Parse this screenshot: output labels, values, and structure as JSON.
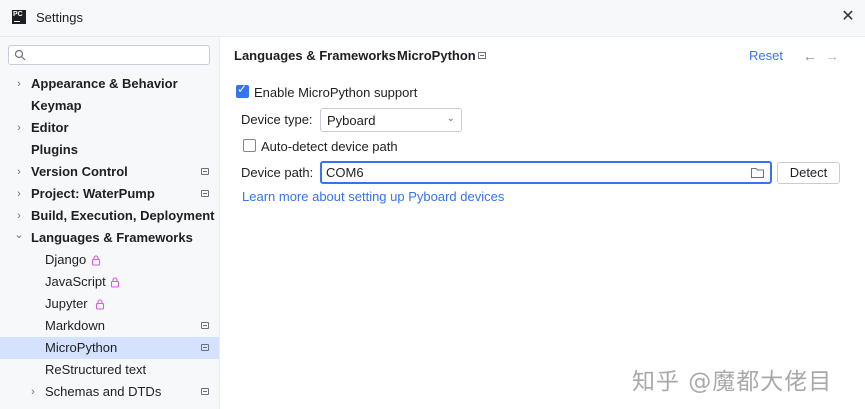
{
  "window": {
    "title": "Settings",
    "app_icon_text": "PC"
  },
  "sidebar": {
    "search_placeholder": "",
    "items": [
      {
        "label": "Appearance & Behavior",
        "arrow": "›"
      },
      {
        "label": "Keymap"
      },
      {
        "label": "Editor",
        "arrow": "›"
      },
      {
        "label": "Plugins"
      },
      {
        "label": "Version Control",
        "arrow": "›"
      },
      {
        "label": "Project: WaterPump",
        "arrow": "›"
      },
      {
        "label": "Build, Execution, Deployment",
        "arrow": "›"
      },
      {
        "label": "Languages & Frameworks",
        "arrow": "⌄"
      },
      {
        "label": "Django"
      },
      {
        "label": "JavaScript"
      },
      {
        "label": "Jupyter"
      },
      {
        "label": "Markdown"
      },
      {
        "label": "MicroPython"
      },
      {
        "label": "ReStructured text"
      },
      {
        "label": "Schemas and DTDs",
        "arrow": "›"
      }
    ]
  },
  "header": {
    "crumb_parent": "Languages & Frameworks",
    "crumb_sep": "›",
    "crumb_current": "MicroPython",
    "reset_label": "Reset",
    "back": "←",
    "forward": "→"
  },
  "form": {
    "enable_label": "Enable MicroPython support",
    "enable_checked": true,
    "device_type_label": "Device type:",
    "device_type_value": "Pyboard",
    "auto_detect_label": "Auto-detect device path",
    "auto_detect_checked": false,
    "device_path_label": "Device path:",
    "device_path_value": "COM6",
    "detect_button": "Detect",
    "learn_more_link": "Learn more about setting up Pyboard devices"
  },
  "watermark": "知乎 @魔都大佬目",
  "colors": {
    "accent": "#3574f0",
    "selection": "#d4e2ff",
    "sidebar_bg": "#f7f8fa",
    "lock": "#d85dd6"
  }
}
